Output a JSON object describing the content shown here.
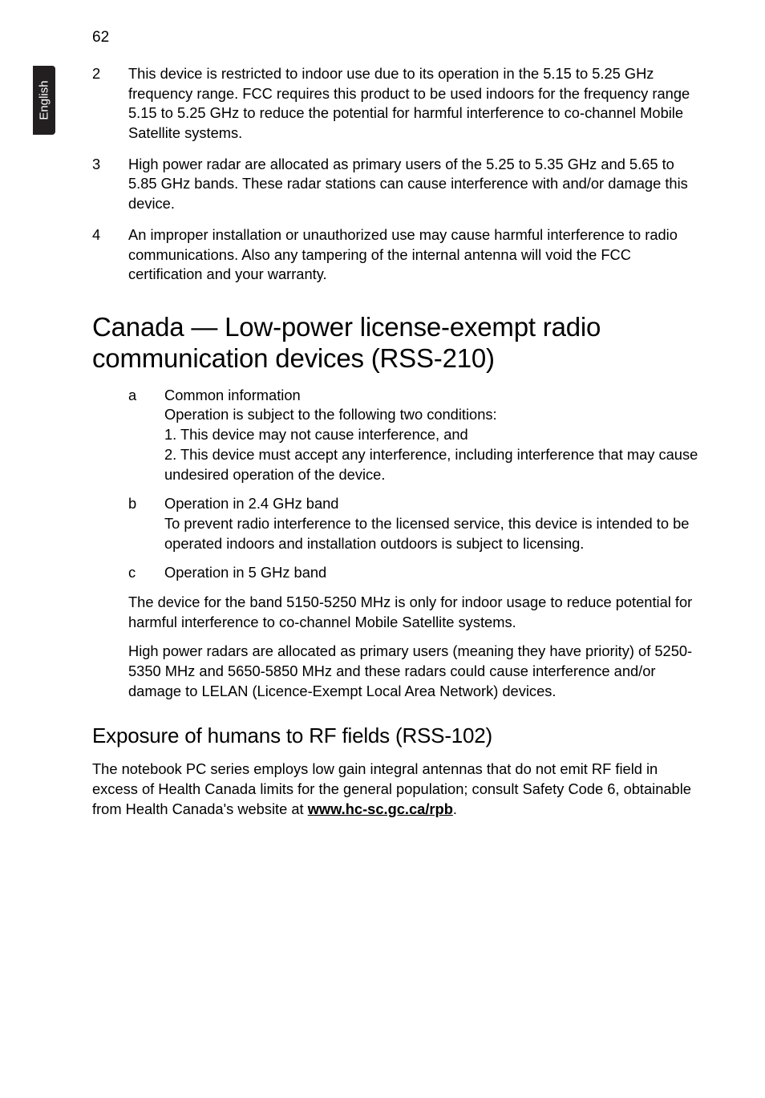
{
  "page_number": "62",
  "side_tab": "English",
  "top_list": [
    {
      "n": "2",
      "text": "This device is restricted to indoor use due to its operation in the 5.15 to 5.25 GHz frequency range. FCC requires this product to be used indoors for the frequency range 5.15 to 5.25 GHz to reduce the potential for harmful interference to co-channel Mobile Satellite systems."
    },
    {
      "n": "3",
      "text": "High power radar are allocated as primary users of the 5.25 to 5.35 GHz and 5.65 to 5.85 GHz bands. These radar stations can cause interference with and/or damage this device."
    },
    {
      "n": "4",
      "text": "An improper installation or unauthorized use may cause harmful interference to radio communications. Also any tampering of the internal antenna will void the FCC certification and your warranty."
    }
  ],
  "heading1": "Canada — Low-power license-exempt radio communication devices (RSS-210)",
  "sub_list": [
    {
      "l": "a",
      "lines": [
        "Common information",
        "Operation is subject to the following two conditions:",
        "1. This device may not cause interference, and",
        "2. This device must accept any interference, including interference that may cause undesired operation of the device."
      ]
    },
    {
      "l": "b",
      "lines": [
        "Operation in 2.4 GHz band",
        "To prevent radio interference to the licensed service, this device is intended to be operated indoors and installation outdoors is subject to licensing."
      ]
    },
    {
      "l": "c",
      "lines": [
        "Operation in 5 GHz band"
      ]
    }
  ],
  "indent_paras": [
    "The device for the band 5150-5250 MHz is only for indoor usage to reduce potential for harmful interference to co-channel Mobile Satellite systems.",
    "High power radars are allocated as primary users (meaning they have priority) of 5250-5350 MHz and 5650-5850 MHz and these radars could cause interference and/or damage to LELAN (Licence-Exempt Local Area Network) devices."
  ],
  "heading2": "Exposure of humans to RF fields (RSS-102)",
  "final_para_pre": "The notebook PC series employs low gain integral antennas that do not emit RF field in excess of Health Canada limits for the general population; consult Safety Code 6, obtainable from Health Canada's website at ",
  "final_link": "www.hc-sc.gc.ca/rpb",
  "final_para_post": "."
}
